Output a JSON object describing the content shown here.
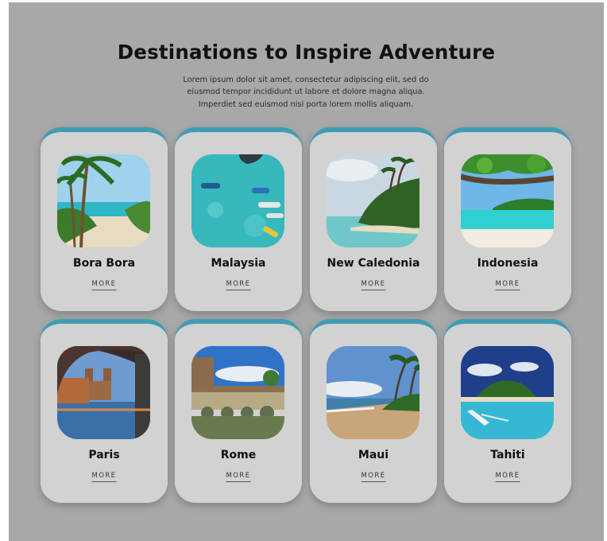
{
  "section": {
    "title": "Destinations to Inspire Adventure",
    "subtitle": "Lorem ipsum dolor sit amet, consectetur adipiscing elit, sed do eiusmod tempor incididunt ut labore et dolore magna aliqua. Imperdiet sed euismod nisi porta lorem mollis aliquam."
  },
  "colors": {
    "background": "#a8a8a8",
    "card": "#d2d2d2",
    "accent": "#3f9db3"
  },
  "destinations": [
    {
      "name": "Bora Bora",
      "more": "MORE",
      "icon": "beach-palm-photo"
    },
    {
      "name": "Malaysia",
      "more": "MORE",
      "icon": "aerial-boats-photo"
    },
    {
      "name": "New Caledonia",
      "more": "MORE",
      "icon": "island-photo"
    },
    {
      "name": "Indonesia",
      "more": "MORE",
      "icon": "lagoon-photo"
    },
    {
      "name": "Paris",
      "more": "MORE",
      "icon": "paris-river-photo"
    },
    {
      "name": "Rome",
      "more": "MORE",
      "icon": "rome-bridge-photo"
    },
    {
      "name": "Maui",
      "more": "MORE",
      "icon": "maui-coast-photo"
    },
    {
      "name": "Tahiti",
      "more": "MORE",
      "icon": "tahiti-boat-photo"
    }
  ]
}
